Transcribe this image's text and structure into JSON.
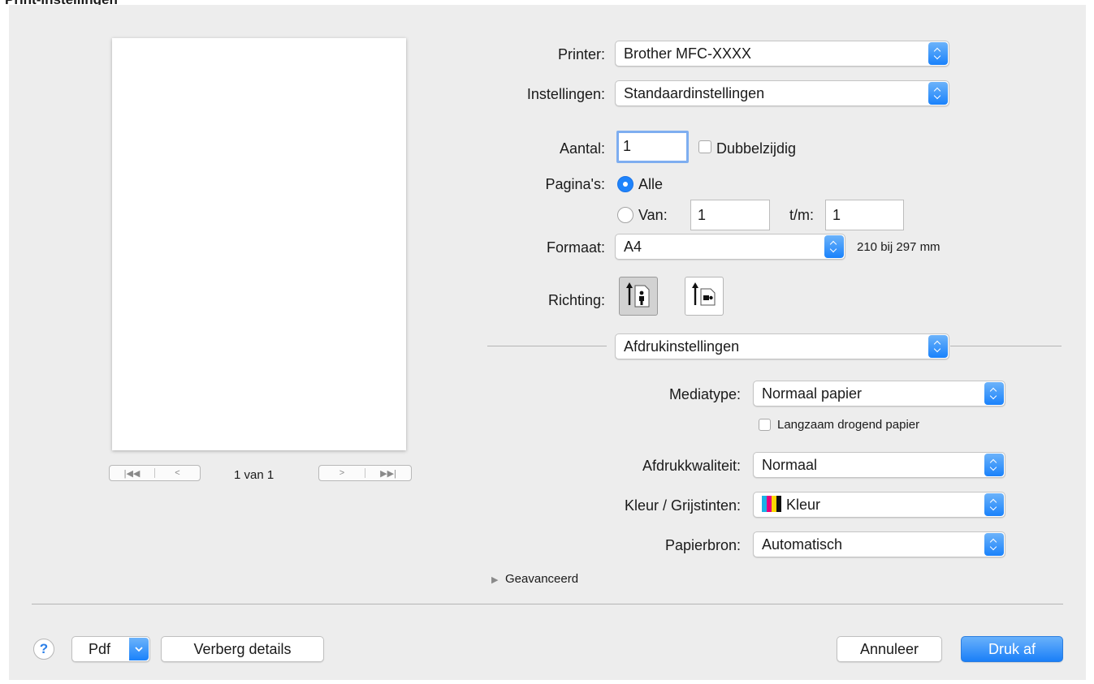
{
  "page_heading": "Print-instellingen",
  "preview": {
    "page_indicator": "1 van 1"
  },
  "printer": {
    "label": "Printer:",
    "value": "Brother MFC-XXXX"
  },
  "presets": {
    "label": "Instellingen:",
    "value": "Standaardinstellingen"
  },
  "copies": {
    "label": "Aantal:",
    "value": "1",
    "duplex_label": "Dubbelzijdig"
  },
  "pages": {
    "label": "Pagina's:",
    "all_label": "Alle",
    "from_label": "Van:",
    "from_value": "1",
    "to_label": "t/m:",
    "to_value": "1"
  },
  "paper_size": {
    "label": "Formaat:",
    "value": "A4",
    "dimensions": "210 bij 297 mm"
  },
  "orientation": {
    "label": "Richting:"
  },
  "section": {
    "value": "Afdrukinstellingen"
  },
  "media_type": {
    "label": "Mediatype:",
    "value": "Normaal papier",
    "slow_drying_label": "Langzaam drogend papier"
  },
  "print_quality": {
    "label": "Afdrukkwaliteit:",
    "value": "Normaal"
  },
  "color_mode": {
    "label": "Kleur / Grijstinten:",
    "value": "Kleur"
  },
  "paper_source": {
    "label": "Papierbron:",
    "value": "Automatisch"
  },
  "advanced": {
    "label": "Geavanceerd"
  },
  "footer": {
    "help_label": "?",
    "pdf_label": "Pdf",
    "hide_details_label": "Verberg details",
    "cancel_label": "Annuleer",
    "print_label": "Druk af"
  },
  "colors": {
    "accent": "#1a7ff8",
    "dialog_bg": "#ededed"
  }
}
